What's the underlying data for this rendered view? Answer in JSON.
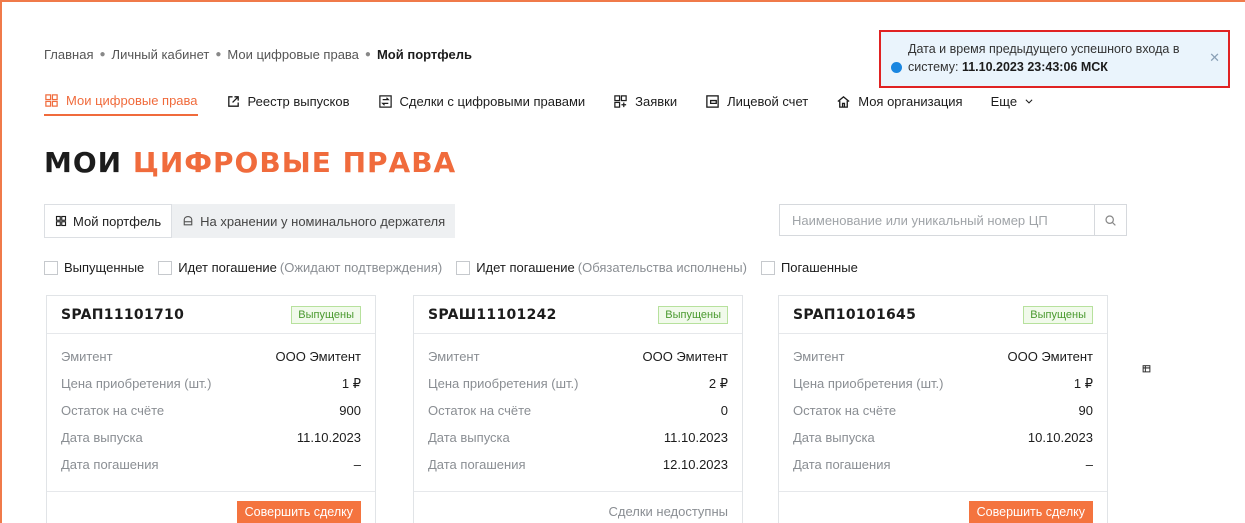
{
  "breadcrumb": [
    "Главная",
    "Личный кабинет",
    "Мои цифровые права",
    "Мой портфель"
  ],
  "nav": {
    "items": [
      {
        "label": "Мои цифровые права",
        "icon": "grid-icon"
      },
      {
        "label": "Реестр выпусков",
        "icon": "external-link-icon"
      },
      {
        "label": "Сделки с цифровыми правами",
        "icon": "exchange-icon"
      },
      {
        "label": "Заявки",
        "icon": "apps-add-icon"
      },
      {
        "label": "Лицевой счет",
        "icon": "account-card-icon"
      },
      {
        "label": "Моя организация",
        "icon": "home-icon"
      },
      {
        "label": "Еще",
        "icon": "chevron-down-icon"
      }
    ]
  },
  "title": {
    "part1": "МОИ",
    "part2": "ЦИФРОВЫЕ ПРАВА"
  },
  "tabs": {
    "portfolio": "Мой портфель",
    "custody": "На хранении у номинального держателя"
  },
  "search": {
    "placeholder": "Наименование или уникальный номер ЦП"
  },
  "filters": {
    "f1": "Выпущенные",
    "f2": "Идет погашение",
    "f2_note": "(Ожидают подтверждения)",
    "f3": "Идет погашение",
    "f3_note": "(Обязательства исполнены)",
    "f4": "Погашенные"
  },
  "labels": {
    "issuer": "Эмитент",
    "price": "Цена приобретения (шт.)",
    "balance": "Остаток на счёте",
    "issue_date": "Дата выпуска",
    "redemption_date": "Дата погашения"
  },
  "cards": [
    {
      "id": "SPAП11101710",
      "status": "Выпущены",
      "issuer": "ООО Эмитент",
      "price": "1 ₽",
      "balance": "900",
      "issue_date": "11.10.2023",
      "redemption_date": "–",
      "action": "Совершить сделку"
    },
    {
      "id": "SPAШ11101242",
      "status": "Выпущены",
      "issuer": "ООО Эмитент",
      "price": "2 ₽",
      "balance": "0",
      "issue_date": "11.10.2023",
      "redemption_date": "12.10.2023",
      "action": "Сделки недоступны"
    },
    {
      "id": "SPAП10101645",
      "status": "Выпущены",
      "issuer": "ООО Эмитент",
      "price": "1 ₽",
      "balance": "90",
      "issue_date": "10.10.2023",
      "redemption_date": "–",
      "action": "Совершить сделку"
    }
  ],
  "toast": {
    "text": "Дата и время предыдущего успешного входа в систему:",
    "datetime": "11.10.2023 23:43:06 МСК"
  },
  "colors": {
    "accent": "#f06b3c",
    "success": "#4a9a2f",
    "info": "#1a86e0",
    "highlight": "#e02222"
  }
}
